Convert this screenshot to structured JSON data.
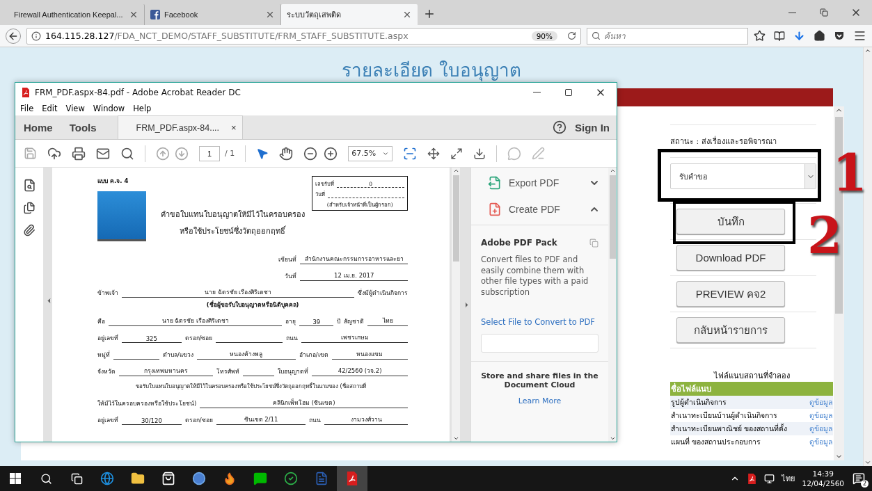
{
  "browser": {
    "tabs": [
      {
        "title": "Firewall Authentication Keepal...",
        "kind": "plain",
        "selected": false
      },
      {
        "title": "Facebook",
        "kind": "facebook",
        "selected": false
      },
      {
        "title": "ระบบวัตถุเสพติด",
        "kind": "plain",
        "selected": true
      }
    ],
    "url_host": "164.115.28.127",
    "url_path": "/FDA_NCT_DEMO/STAFF_SUBSTITUTE/FRM_STAFF_SUBSTITUTE.aspx",
    "zoom": "90%",
    "search_placeholder": "ค้นหา"
  },
  "page": {
    "title": "รายละเอียด ใบอนุญาต",
    "status": "สถานะ : ส่งเรื่องและรอพิจารณา",
    "select_value": "รับคำขอ",
    "buttons": [
      "บันทึก",
      "Download PDF",
      "PREVIEW คจ2",
      "กลับหน้ารายการ"
    ],
    "attachments": {
      "caption": "ไฟล์แนบสถานที่จำลอง",
      "header": "ชื่อไฟล์แนบ",
      "rows": [
        {
          "name": "รูปผู้ดำเนินกิจการ",
          "link": "ดูข้อมูล"
        },
        {
          "name": "สำเนาทะเบียนบ้านผู้ดำเนินกิจการ",
          "link": "ดูข้อมูล"
        },
        {
          "name": "สำเนาทะเบียนพาณิชย์ ของสถานที่ตั้ง",
          "link": "ดูข้อมูล"
        },
        {
          "name": "แผนที่ ของสถานประกอบการ",
          "link": "ดูข้อมูล"
        }
      ]
    },
    "annotations": [
      "1",
      "2"
    ]
  },
  "acrobat": {
    "title": "FRM_PDF.aspx-84.pdf - Adobe Acrobat Reader DC",
    "menu": [
      "File",
      "Edit",
      "View",
      "Window",
      "Help"
    ],
    "nav": [
      "Home",
      "Tools"
    ],
    "doc_tab": "FRM_PDF.aspx-84....",
    "close_mark": "×",
    "sign_in": "Sign In",
    "page_number": "1",
    "page_total": "/ 1",
    "zoom": "67.5%",
    "tools": [
      {
        "label": "Export PDF",
        "kind": "export",
        "expanded": false
      },
      {
        "label": "Create PDF",
        "kind": "create",
        "expanded": true
      }
    ],
    "pack": {
      "title": "Adobe PDF Pack",
      "description": "Convert files to PDF and easily combine them with other file types with a paid subscription",
      "link": "Select File to Convert to PDF"
    },
    "cloud": {
      "text": "Store and share files in the Document Cloud",
      "link": "Learn More"
    }
  },
  "document": {
    "form_code": "แบบ ค.จ. 4",
    "receipt": {
      "number_label": "เลขรับที่",
      "number": "0",
      "date_label": "วันที่",
      "note": "(สำหรับเจ้าหน้าที่เป็นผู้กรอก)"
    },
    "title_lines": [
      "คำขอใบแทนใบอนุญาตให้มีไว้ในครอบครอง",
      "หรือใช้ประโยชน์ซึ่งวัตถุออกฤทธิ์"
    ],
    "rows": [
      {
        "kind": "right_fields",
        "items": [
          {
            "kind": "label",
            "text": "เขียนที่"
          },
          {
            "kind": "value",
            "text": "สำนักงานคณะกรรมการอาหารและยา"
          }
        ]
      },
      {
        "kind": "right_fields",
        "items": [
          {
            "kind": "label",
            "text": "วันที่"
          },
          {
            "kind": "value",
            "text": "12 เม.ย. 2017"
          }
        ]
      },
      {
        "kind": "fields",
        "items": [
          {
            "kind": "label",
            "text": "ข้าพเจ้า"
          },
          {
            "kind": "value",
            "text": "นาย ฉัตรชัย เรืองศิริเดชา"
          },
          {
            "kind": "label",
            "text": "ซึ่งมีผู้ดำเนินกิจการ"
          }
        ]
      },
      {
        "kind": "caption",
        "text": "(ชื่อผู้ขอรับใบอนุญาตหรือนิติบุคคล)"
      },
      {
        "kind": "fields",
        "items": [
          {
            "kind": "label",
            "text": "คือ"
          },
          {
            "kind": "value",
            "text": "นาย ฉัตรชัย เรืองศิริเดชา"
          },
          {
            "kind": "label",
            "text": "อายุ"
          },
          {
            "kind": "value",
            "text": "39"
          },
          {
            "kind": "label",
            "text": "ปี"
          },
          {
            "kind": "label",
            "text": "สัญชาติ"
          },
          {
            "kind": "value",
            "text": "ไทย"
          }
        ]
      },
      {
        "kind": "fields",
        "items": [
          {
            "kind": "label",
            "text": "อยู่เลขที่"
          },
          {
            "kind": "value",
            "text": "325"
          },
          {
            "kind": "label",
            "text": "ตรอก/ซอย"
          },
          {
            "kind": "blank"
          },
          {
            "kind": "label",
            "text": "ถนน"
          },
          {
            "kind": "value",
            "text": "เพชรเกษม"
          }
        ]
      },
      {
        "kind": "fields",
        "items": [
          {
            "kind": "label",
            "text": "หมู่ที่"
          },
          {
            "kind": "blank"
          },
          {
            "kind": "label",
            "text": "ตำบล/แขวง"
          },
          {
            "kind": "value",
            "text": "หนองค้างพลู"
          },
          {
            "kind": "label",
            "text": "อำเภอ/เขต"
          },
          {
            "kind": "value",
            "text": "หนองแขม"
          }
        ]
      },
      {
        "kind": "fields",
        "items": [
          {
            "kind": "label",
            "text": "จังหวัด"
          },
          {
            "kind": "value",
            "text": "กรุงเทพมหานคร"
          },
          {
            "kind": "label",
            "text": "โทรศัพท์"
          },
          {
            "kind": "blank"
          },
          {
            "kind": "label",
            "text": "ใบอนุญาตที่"
          },
          {
            "kind": "value",
            "text": "42/2560 (วจ.2)"
          }
        ]
      },
      {
        "kind": "paragraph",
        "text": "ขอรับใบแทนใบอนุญาตให้มีไว้ในครอบครองหรือใช้ประโยชน์ซึ่งวัตถุออกฤทธิ์ในนามของ (ชื่อสถานที่"
      },
      {
        "kind": "fields",
        "items": [
          {
            "kind": "label",
            "text": "ให้มีไว้ในครอบครองหรือใช้ประโยชน์)"
          },
          {
            "kind": "value",
            "text": "คลินิกเพ็ทโฮม (ซินเขต)"
          }
        ]
      },
      {
        "kind": "fields",
        "items": [
          {
            "kind": "label",
            "text": "อยู่เลขที่"
          },
          {
            "kind": "value",
            "text": "30/120"
          },
          {
            "kind": "label",
            "text": "ตรอก/ซอย"
          },
          {
            "kind": "value",
            "text": "ซินเขต 2/11"
          },
          {
            "kind": "label",
            "text": "ถนน"
          },
          {
            "kind": "value",
            "text": "งามวงศ์วาน"
          }
        ]
      }
    ]
  },
  "taskbar": {
    "language": "ไทย",
    "time": "14:39",
    "date": "12/04/2560",
    "notifications": "2"
  }
}
